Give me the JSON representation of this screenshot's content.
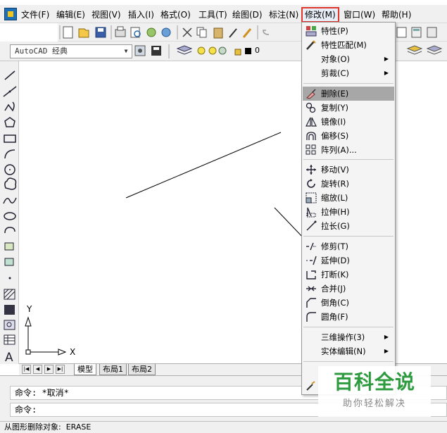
{
  "menubar": {
    "items": [
      "文件(F)",
      "编辑(E)",
      "视图(V)",
      "插入(I)",
      "格式(O)",
      "工具(T)",
      "绘图(D)",
      "标注(N)",
      "修改(M)",
      "窗口(W)",
      "帮助(H)"
    ]
  },
  "toolbar": {
    "workspace": "AutoCAD 经典",
    "layer": "0"
  },
  "canvas": {
    "ucs_y": "Y",
    "ucs_x": "X"
  },
  "tabs": [
    "模型",
    "布局1",
    "布局2"
  ],
  "command": {
    "history": "命令: *取消*",
    "prompt": "命令:"
  },
  "status": "从图形删除对象:  ERASE",
  "modify_menu": {
    "items": [
      {
        "label": "特性(P)",
        "icon": "properties-icon"
      },
      {
        "label": "特性匹配(M)",
        "icon": "match-properties-icon"
      },
      {
        "label": "对象(O)",
        "icon": "",
        "submenu": true
      },
      {
        "label": "剪裁(C)",
        "icon": "",
        "submenu": true
      },
      {
        "label": "删除(E)",
        "icon": "erase-icon",
        "highlighted": true
      },
      {
        "label": "复制(Y)",
        "icon": "copy-icon"
      },
      {
        "label": "镜像(I)",
        "icon": "mirror-icon"
      },
      {
        "label": "偏移(S)",
        "icon": "offset-icon"
      },
      {
        "label": "阵列(A)...",
        "icon": "array-icon"
      },
      {
        "label": "移动(V)",
        "icon": "move-icon"
      },
      {
        "label": "旋转(R)",
        "icon": "rotate-icon"
      },
      {
        "label": "缩放(L)",
        "icon": "scale-icon"
      },
      {
        "label": "拉伸(H)",
        "icon": "stretch-icon"
      },
      {
        "label": "拉长(G)",
        "icon": "lengthen-icon"
      },
      {
        "label": "修剪(T)",
        "icon": "trim-icon"
      },
      {
        "label": "延伸(D)",
        "icon": "extend-icon"
      },
      {
        "label": "打断(K)",
        "icon": "break-icon"
      },
      {
        "label": "合并(J)",
        "icon": "join-icon"
      },
      {
        "label": "倒角(C)",
        "icon": "chamfer-icon"
      },
      {
        "label": "圆角(F)",
        "icon": "fillet-icon"
      },
      {
        "label": "三维操作(3)",
        "icon": "",
        "submenu": true
      },
      {
        "label": "实体编辑(N)",
        "icon": "",
        "submenu": true
      }
    ]
  },
  "watermark": {
    "logo": "百科全说",
    "sub": "助你轻松解决"
  },
  "colors": {
    "menu_highlight_border": "#e0352b",
    "arrow": "#e0352b",
    "watermark_green": "#2e9b3f",
    "selected_item": "#a7a7a7"
  }
}
